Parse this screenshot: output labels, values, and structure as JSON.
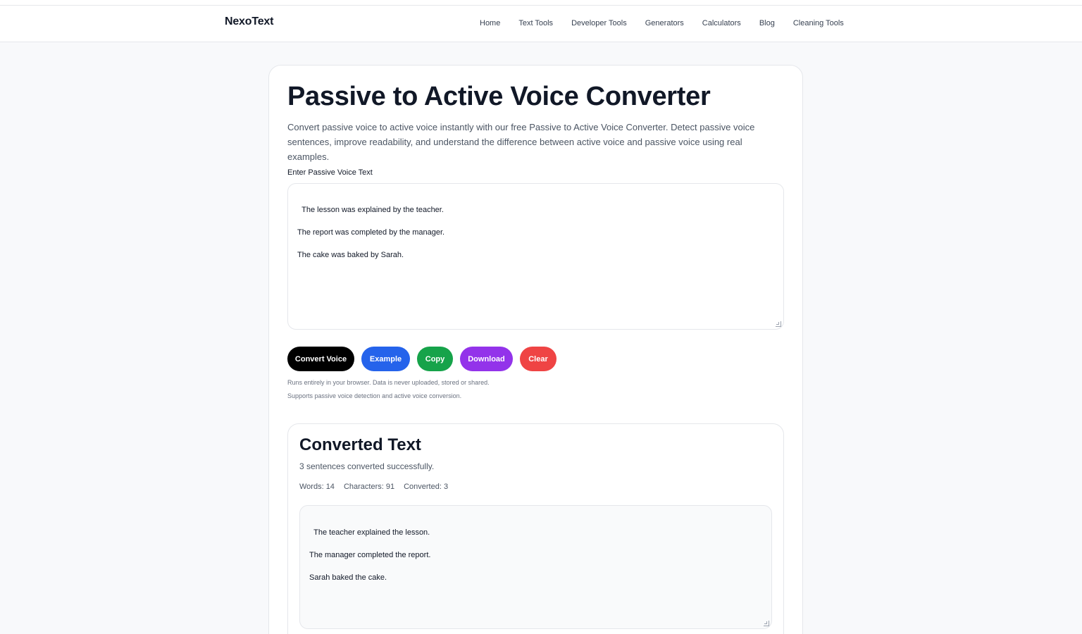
{
  "nav": {
    "logo": "NexoText",
    "links": [
      "Home",
      "Text Tools",
      "Developer Tools",
      "Generators",
      "Calculators",
      "Blog",
      "Cleaning Tools"
    ]
  },
  "tool": {
    "title": "Passive to Active Voice Converter",
    "description": "Convert passive voice to active voice instantly with our free Passive to Active Voice Converter. Detect passive voice sentences, improve readability, and understand the difference between active voice and passive voice using real examples.",
    "input_label": "Enter Passive Voice Text",
    "input_value": "The lesson was explained by the teacher.\n\nThe report was completed by the manager.\n\nThe cake was baked by Sarah.",
    "buttons": {
      "convert": "Convert Voice",
      "example": "Example",
      "copy": "Copy",
      "download": "Download",
      "clear": "Clear"
    },
    "button_colors": {
      "convert": "#000000",
      "example": "#2563eb",
      "copy": "#16a34a",
      "download": "#9333ea",
      "clear": "#ef4444"
    },
    "notes": [
      "Runs entirely in your browser. Data is never uploaded, stored or shared.",
      "Supports passive voice detection and active voice conversion."
    ]
  },
  "result": {
    "title": "Converted Text",
    "status": "3 sentences converted successfully.",
    "stats": {
      "words": "Words: 14",
      "characters": "Characters: 91",
      "converted": "Converted: 3"
    },
    "output_value": "The teacher explained the lesson.\n\nThe manager completed the report.\n\nSarah baked the cake."
  }
}
